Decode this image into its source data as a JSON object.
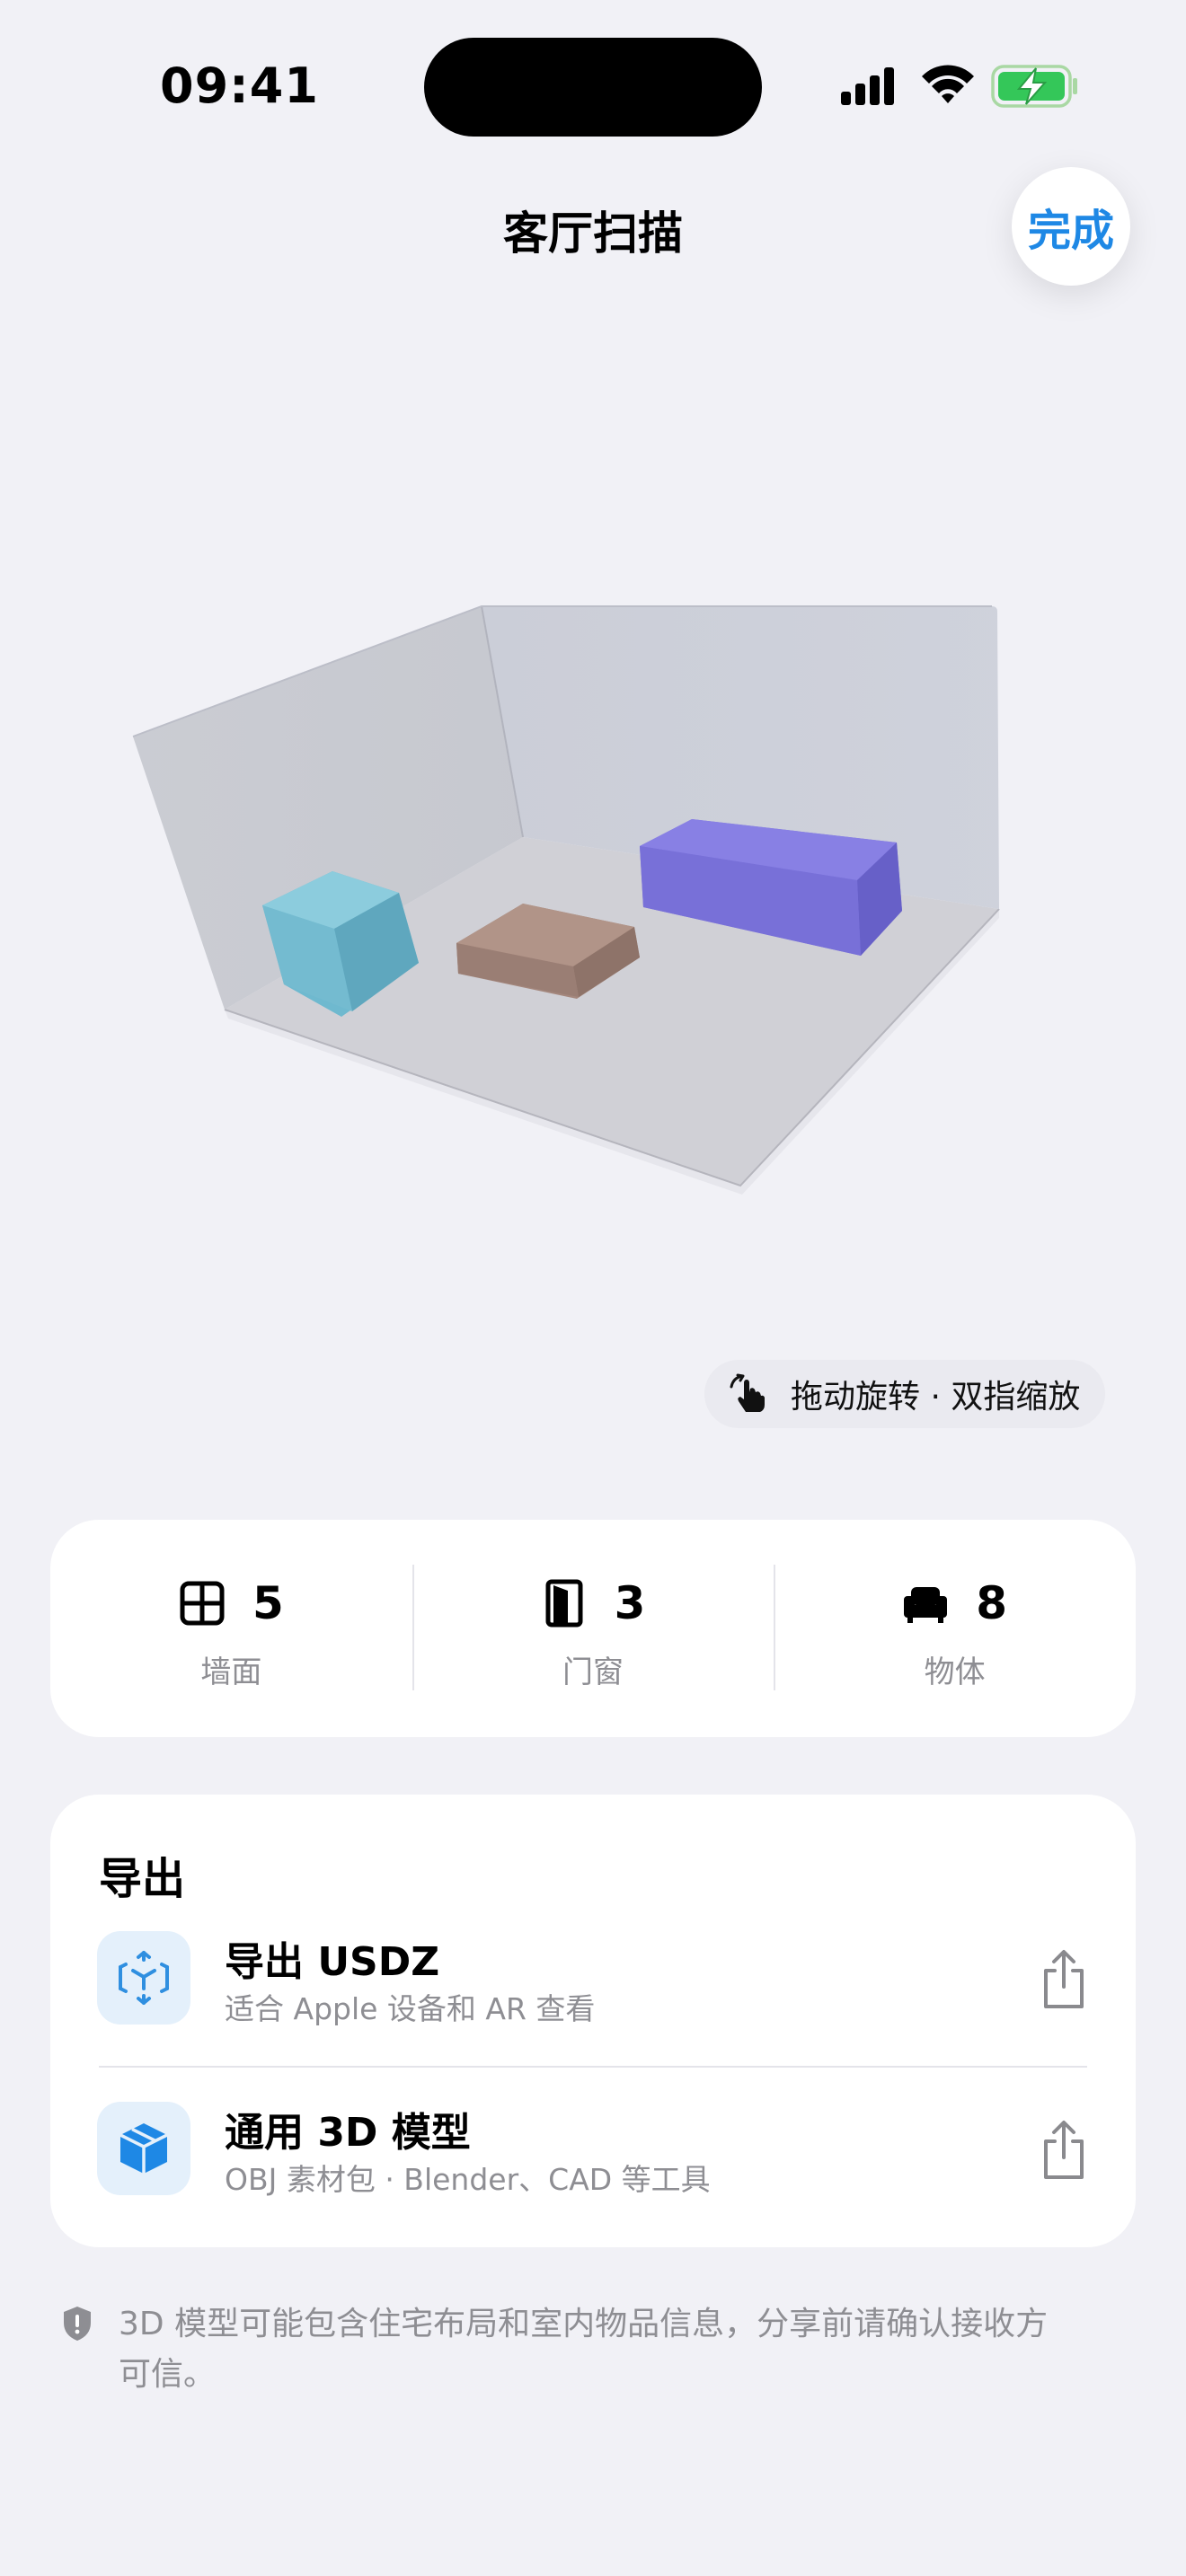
{
  "status_bar": {
    "time": "09:41"
  },
  "nav": {
    "title": "客厅扫描",
    "done_label": "完成"
  },
  "viewer": {
    "hint": "拖动旋转 · 双指缩放"
  },
  "stats": [
    {
      "value": "5",
      "label": "墙面",
      "icon": "grid-icon"
    },
    {
      "value": "3",
      "label": "门窗",
      "icon": "door-icon"
    },
    {
      "value": "8",
      "label": "物体",
      "icon": "armchair-icon"
    }
  ],
  "export": {
    "header": "导出",
    "items": [
      {
        "title": "导出 USDZ",
        "subtitle": "适合 Apple 设备和 AR 查看",
        "icon": "ar-cube-icon"
      },
      {
        "title": "通用 3D 模型",
        "subtitle": "OBJ 素材包 · Blender、CAD 等工具",
        "icon": "cube-icon"
      }
    ]
  },
  "privacy_note": "3D 模型可能包含住宅布局和室内物品信息，分享前请确认接收方可信。",
  "colors": {
    "accent": "#1E88E5",
    "background": "#F1F1F6",
    "object_cyan": "#6FB9CF",
    "object_brown": "#A4877D",
    "object_purple": "#7B73DE"
  }
}
